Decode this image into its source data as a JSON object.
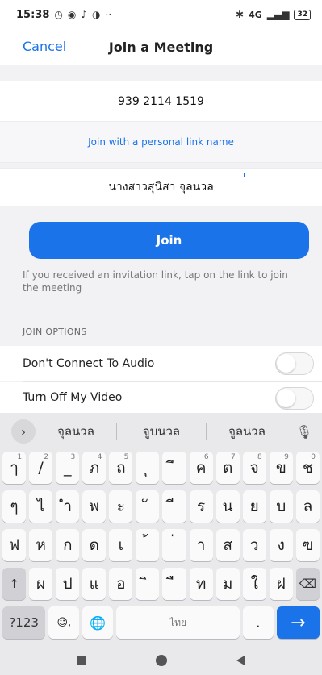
{
  "status_bar": {
    "time": "15:38",
    "icons": [
      "alarm-icon",
      "messenger-icon",
      "tiktok-icon",
      "app-icon"
    ],
    "more": "··",
    "bluetooth": "bluetooth-icon",
    "network": "4G",
    "battery": "32"
  },
  "header": {
    "cancel_label": "Cancel",
    "title": "Join a Meeting"
  },
  "meeting": {
    "meeting_id": "939 2114 1519",
    "personal_link_label": "Join with a personal link name",
    "display_name": "นางสาวสุนิสา จุลนวล"
  },
  "join_button_label": "Join",
  "hint_text": "If you received an invitation link, tap on the link to join the meeting",
  "options": {
    "section_label": "JOIN OPTIONS",
    "items": [
      {
        "label": "Don't Connect To Audio",
        "on": false
      },
      {
        "label": "Turn Off My Video",
        "on": false
      }
    ]
  },
  "keyboard": {
    "suggestions": [
      "จุลนวล",
      "จูบนวล",
      "จูลนวล"
    ],
    "rows": [
      [
        {
          "c": "ๅ",
          "n": "1"
        },
        {
          "c": "/",
          "n": "2"
        },
        {
          "c": "_",
          "n": "3"
        },
        {
          "c": "ภ",
          "n": "4"
        },
        {
          "c": "ถ",
          "n": "5"
        },
        {
          "c": "ุ",
          "n": ""
        },
        {
          "c": "ึ",
          "n": ""
        },
        {
          "c": "ค",
          "n": "6"
        },
        {
          "c": "ต",
          "n": "7"
        },
        {
          "c": "จ",
          "n": "8"
        },
        {
          "c": "ข",
          "n": "9"
        },
        {
          "c": "ช",
          "n": "0"
        }
      ],
      [
        {
          "c": "ๆ",
          "n": ""
        },
        {
          "c": "ไ",
          "n": ""
        },
        {
          "c": "ำ",
          "n": ""
        },
        {
          "c": "พ",
          "n": ""
        },
        {
          "c": "ะ",
          "n": ""
        },
        {
          "c": "ั",
          "n": ""
        },
        {
          "c": "ี",
          "n": ""
        },
        {
          "c": "ร",
          "n": ""
        },
        {
          "c": "น",
          "n": ""
        },
        {
          "c": "ย",
          "n": ""
        },
        {
          "c": "บ",
          "n": ""
        },
        {
          "c": "ล",
          "n": ""
        }
      ],
      [
        {
          "c": "ฟ",
          "n": ""
        },
        {
          "c": "ห",
          "n": ""
        },
        {
          "c": "ก",
          "n": ""
        },
        {
          "c": "ด",
          "n": ""
        },
        {
          "c": "เ",
          "n": ""
        },
        {
          "c": "้",
          "n": ""
        },
        {
          "c": "่",
          "n": ""
        },
        {
          "c": "า",
          "n": ""
        },
        {
          "c": "ส",
          "n": ""
        },
        {
          "c": "ว",
          "n": ""
        },
        {
          "c": "ง",
          "n": ""
        },
        {
          "c": "ฃ",
          "n": ""
        }
      ],
      [
        {
          "c": "↑",
          "n": ""
        },
        {
          "c": "ผ",
          "n": ""
        },
        {
          "c": "ป",
          "n": ""
        },
        {
          "c": "แ",
          "n": ""
        },
        {
          "c": "อ",
          "n": ""
        },
        {
          "c": "ิ",
          "n": ""
        },
        {
          "c": "ื",
          "n": ""
        },
        {
          "c": "ท",
          "n": ""
        },
        {
          "c": "ม",
          "n": ""
        },
        {
          "c": "ใ",
          "n": ""
        },
        {
          "c": "ฝ",
          "n": ""
        },
        {
          "c": "⌫",
          "n": ""
        }
      ]
    ],
    "bottom": {
      "mode_label": "?123",
      "emoji_comma": "☺,",
      "globe": "🌐",
      "space_label": "ไทย",
      "period": ".",
      "enter": "→"
    }
  }
}
